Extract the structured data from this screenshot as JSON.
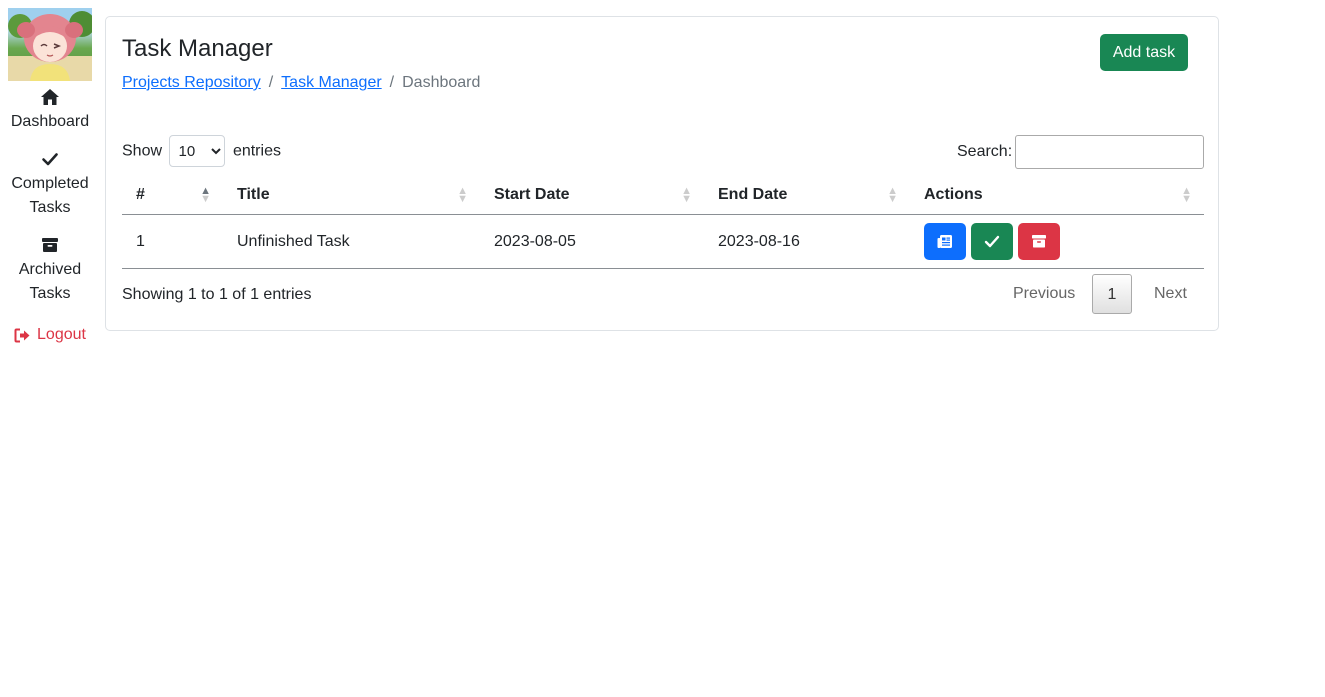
{
  "sidebar": {
    "items": [
      {
        "label": "Dashboard",
        "icon": "home-icon"
      },
      {
        "label": "Completed Tasks",
        "icon": "check-icon"
      },
      {
        "label": "Archived Tasks",
        "icon": "archive-icon"
      }
    ],
    "logout": {
      "label": "Logout",
      "icon": "sign-out-icon",
      "color": "#dc3545"
    }
  },
  "header": {
    "title": "Task Manager",
    "add_task_label": "Add task",
    "breadcrumb": [
      "Projects Repository",
      "Task Manager",
      "Dashboard"
    ]
  },
  "table": {
    "length_prefix": "Show",
    "length_value": "10",
    "length_suffix": "entries",
    "search_label": "Search:",
    "search_value": "",
    "columns": [
      "#",
      "Title",
      "Start Date",
      "End Date",
      "Actions"
    ],
    "rows": [
      {
        "num": "1",
        "title": "Unfinished Task",
        "start": "2023-08-05",
        "end": "2023-08-16"
      }
    ],
    "info": "Showing 1 to 1 of 1 entries",
    "pagination": {
      "previous": "Previous",
      "current": "1",
      "next": "Next"
    }
  },
  "colors": {
    "primary": "#0d6efd",
    "success": "#198754",
    "danger": "#dc3545"
  }
}
